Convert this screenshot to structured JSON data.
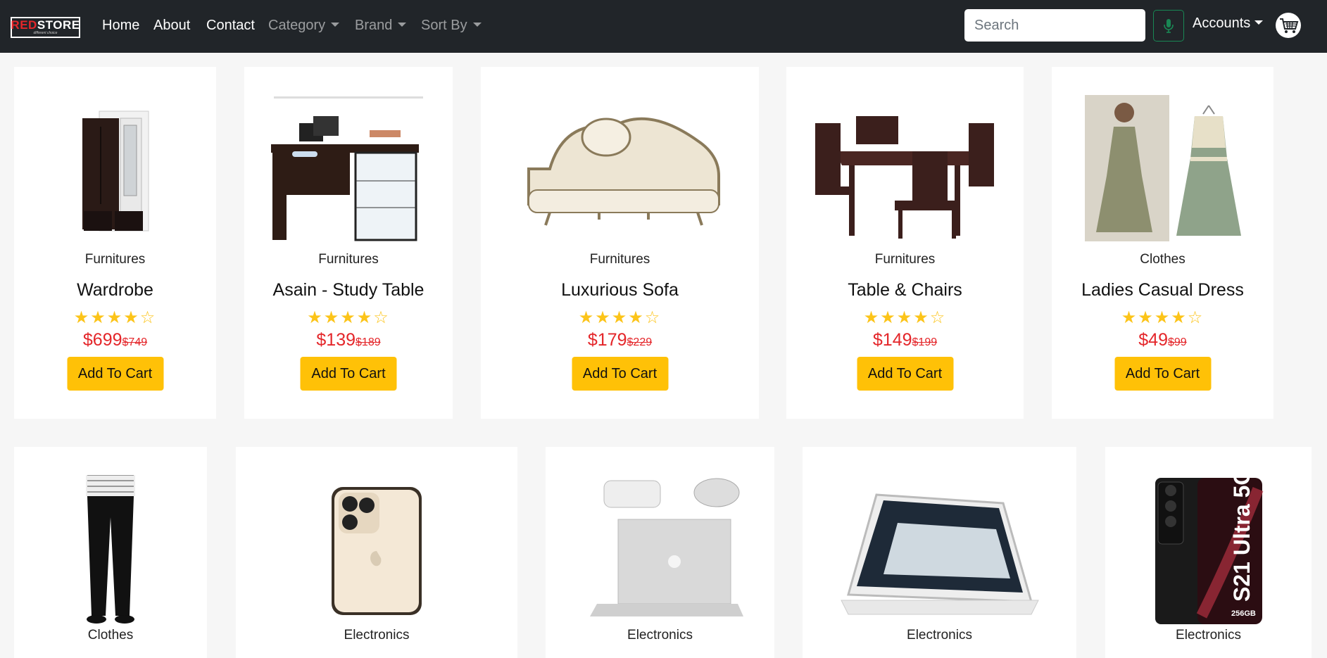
{
  "nav": {
    "brand_main_red": "RED",
    "brand_main_white": "STORE",
    "brand_sub": "different choice",
    "links": [
      "Home",
      "About",
      "Contact"
    ],
    "dropdowns": [
      "Category",
      "Brand",
      "Sort By"
    ],
    "search_placeholder": "Search",
    "accounts_label": "Accounts"
  },
  "colors": {
    "navbar": "#212529",
    "accent_button": "#ffc107",
    "price": "#e4262a",
    "star": "#fcc419",
    "mic_border": "#198754"
  },
  "products": [
    {
      "category": "Furnitures",
      "title": "Wardrobe",
      "rating": 4,
      "price": "$699",
      "old_price": "$749",
      "button": "Add To Cart",
      "image": "wardrobe"
    },
    {
      "category": "Furnitures",
      "title": "Asain - Study Table",
      "rating": 4,
      "price": "$139",
      "old_price": "$189",
      "button": "Add To Cart",
      "image": "study-table"
    },
    {
      "category": "Furnitures",
      "title": "Luxurious Sofa",
      "rating": 4,
      "price": "$179",
      "old_price": "$229",
      "button": "Add To Cart",
      "image": "sofa"
    },
    {
      "category": "Furnitures",
      "title": "Table & Chairs",
      "rating": 4,
      "price": "$149",
      "old_price": "$199",
      "button": "Add To Cart",
      "image": "table-chairs"
    },
    {
      "category": "Clothes",
      "title": "Ladies Casual Dress",
      "rating": 4,
      "price": "$49",
      "old_price": "$99",
      "button": "Add To Cart",
      "image": "dress"
    },
    {
      "category": "Clothes",
      "image": "jeans"
    },
    {
      "category": "Electronics",
      "image": "iphone"
    },
    {
      "category": "Electronics",
      "image": "macbook"
    },
    {
      "category": "Electronics",
      "image": "tablet"
    },
    {
      "category": "Electronics",
      "image": "galaxy-s21",
      "image_text": "S21 Ultra 5G",
      "image_subtext": "256GB"
    }
  ]
}
